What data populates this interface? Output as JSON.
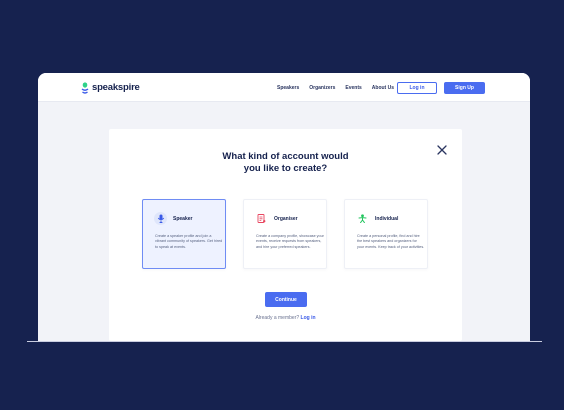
{
  "nav": {
    "brand": "speakspire",
    "links": [
      "Speakers",
      "Organizers",
      "Events",
      "About Us"
    ],
    "login_label": "Log in",
    "signup_label": "Sign Up"
  },
  "modal": {
    "title_line1": "What kind of account would",
    "title_line2": "you like to create?",
    "cards": [
      {
        "title": "Speaker",
        "icon": "microphone-icon",
        "selected": true,
        "description": "Create a speaker profile and join a vibrant community of speakers. Get hired to speak at events."
      },
      {
        "title": "Organiser",
        "icon": "document-icon",
        "selected": false,
        "description": "Create a company profile, showcase your events, receive requests from speakers, and hire your preferred speakers."
      },
      {
        "title": "Individual",
        "icon": "person-icon",
        "selected": false,
        "description": "Create a personal profile, find and hire the best speakers and organizers for your events. Keep track of your activities."
      }
    ],
    "continue_label": "Continue",
    "member_text": "Already a member?",
    "member_link": "Log in"
  },
  "colors": {
    "background": "#16224f",
    "accent": "#4a6cf0",
    "speaker_icon": "#3a5ae8",
    "organiser_icon": "#e8455f",
    "individual_icon": "#22c55e"
  }
}
